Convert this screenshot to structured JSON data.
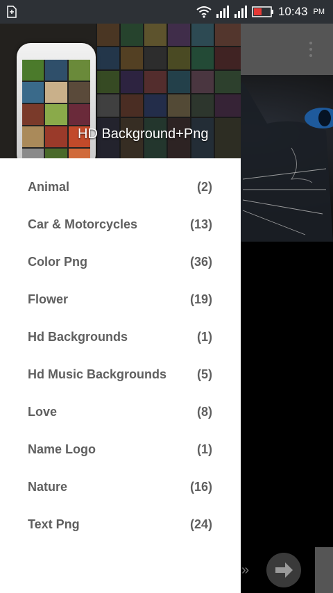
{
  "status_bar": {
    "time": "10:43",
    "ampm": "PM"
  },
  "drawer": {
    "title": "HD Background+Png",
    "categories": [
      {
        "label": "Animal",
        "count": "(2)"
      },
      {
        "label": "Car & Motorcycles",
        "count": "(13)"
      },
      {
        "label": "Color Png",
        "count": "(36)"
      },
      {
        "label": "Flower",
        "count": "(19)"
      },
      {
        "label": "Hd Backgrounds",
        "count": "(1)"
      },
      {
        "label": "Hd Music Backgrounds",
        "count": "(5)"
      },
      {
        "label": "Love",
        "count": "(8)"
      },
      {
        "label": "Name Logo",
        "count": "(1)"
      },
      {
        "label": "Nature",
        "count": "(16)"
      },
      {
        "label": "Text Png",
        "count": "(24)"
      }
    ]
  },
  "background": {
    "chevrons": "»"
  },
  "icons": [
    "sim-card-icon",
    "wifi-icon",
    "signal-icon",
    "battery-icon",
    "overflow-menu-icon",
    "arrow-right-icon"
  ],
  "colors": {
    "status_bar": "#2d3136",
    "drawer_text": "#5f5f5f",
    "toolbar": "#555555"
  }
}
